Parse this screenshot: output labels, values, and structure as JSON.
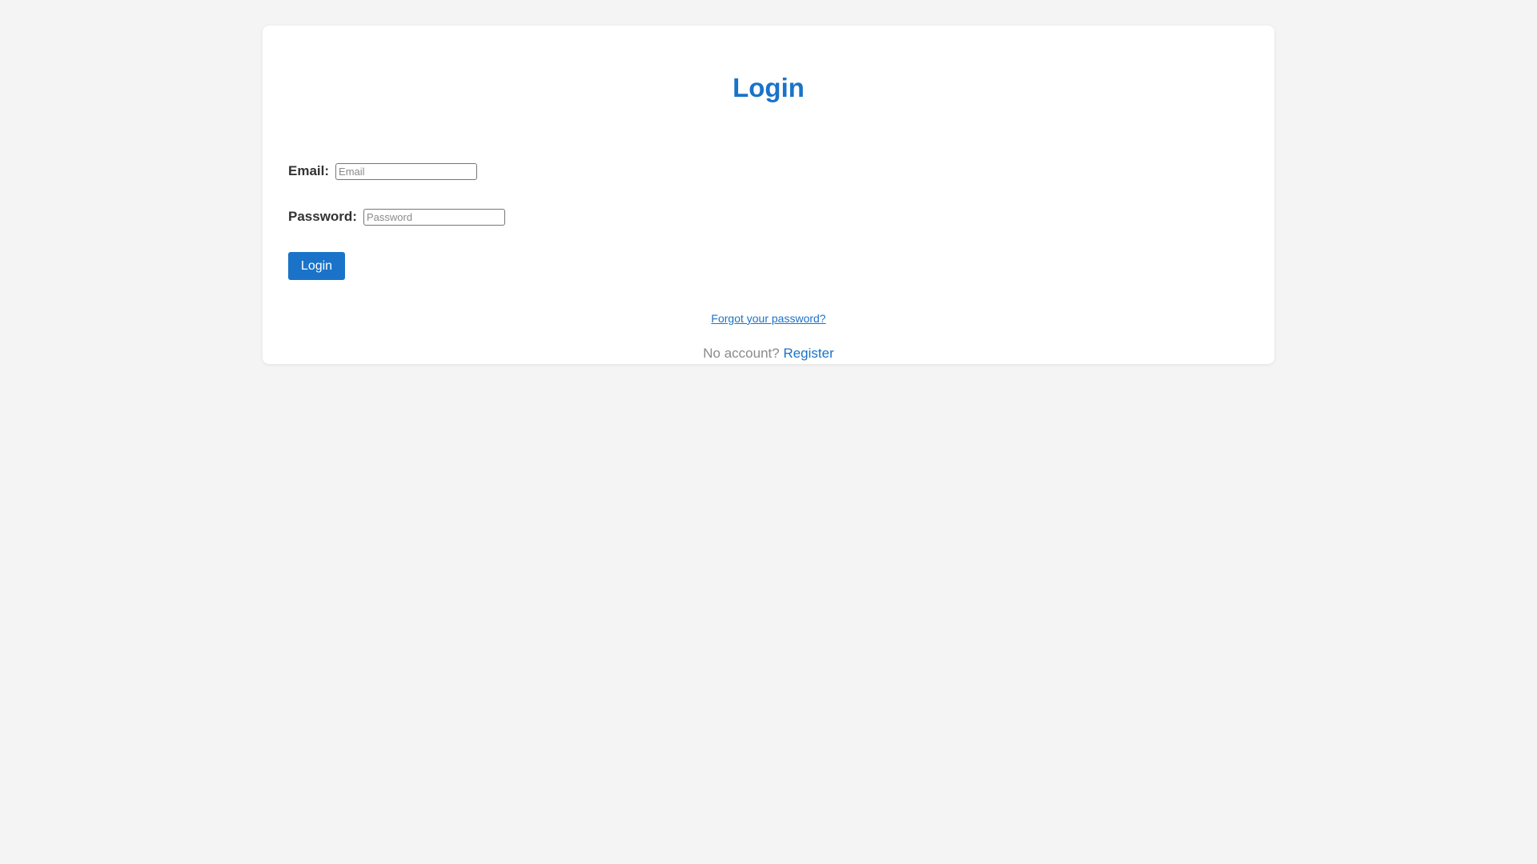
{
  "login_form": {
    "title": "Login",
    "email": {
      "label": "Email:",
      "placeholder": "Email",
      "value": ""
    },
    "password": {
      "label": "Password:",
      "placeholder": "Password",
      "value": ""
    },
    "submit_label": "Login",
    "forgot_password_link": "Forgot your password?",
    "no_account_text": "No account?",
    "register_link": "Register"
  },
  "colors": {
    "accent": "#1a73c8",
    "background": "#f4f4f4",
    "card": "#ffffff",
    "muted_text": "#8a8a8a"
  }
}
